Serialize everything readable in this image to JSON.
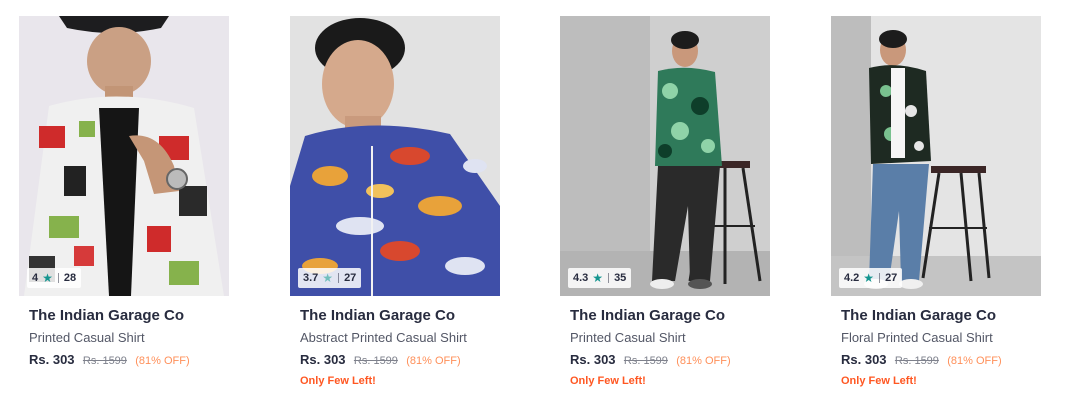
{
  "products": [
    {
      "rating": "4",
      "rating_count": "28",
      "brand": "The Indian Garage Co",
      "name": "Printed Casual Shirt",
      "price": "Rs. 303",
      "mrp": "Rs. 1599",
      "discount": "(81% OFF)",
      "stock_note": ""
    },
    {
      "rating": "3.7",
      "rating_count": "27",
      "brand": "The Indian Garage Co",
      "name": "Abstract Printed Casual Shirt",
      "price": "Rs. 303",
      "mrp": "Rs. 1599",
      "discount": "(81% OFF)",
      "stock_note": "Only Few Left!"
    },
    {
      "rating": "4.3",
      "rating_count": "35",
      "brand": "The Indian Garage Co",
      "name": "Printed Casual Shirt",
      "price": "Rs. 303",
      "mrp": "Rs. 1599",
      "discount": "(81% OFF)",
      "stock_note": "Only Few Left!"
    },
    {
      "rating": "4.2",
      "rating_count": "27",
      "brand": "The Indian Garage Co",
      "name": "Floral Printed Casual Shirt",
      "price": "Rs. 303",
      "mrp": "Rs. 1599",
      "discount": "(81% OFF)",
      "stock_note": "Only Few Left!"
    }
  ],
  "colors": {
    "rating_star": "#14958f",
    "discount": "#ff905a",
    "stock_note": "#ff5722",
    "brand_text": "#282c3f"
  },
  "icons": {
    "rating": "star-icon"
  }
}
